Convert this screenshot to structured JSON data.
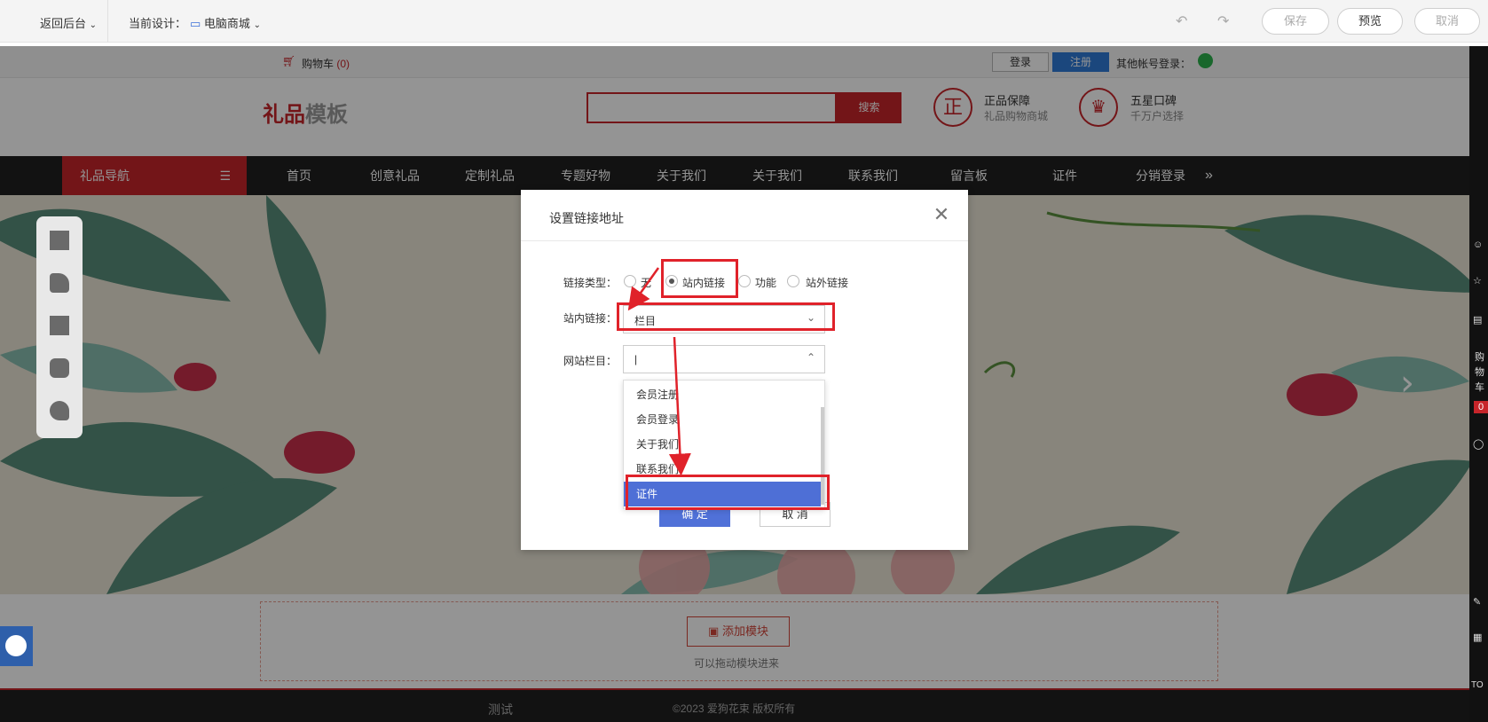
{
  "topbar": {
    "back": "返回后台",
    "current_design_label": "当前设计：",
    "current_design_value": "电脑商城",
    "save": "保存",
    "preview": "预览",
    "cancel": "取消"
  },
  "subbar": {
    "cart": "购物车",
    "cart_count": "(0)",
    "login": "登录",
    "register": "注册",
    "other_login": "其他帐号登录："
  },
  "header": {
    "logo_red": "礼品",
    "logo_gray": "模板",
    "search_button": "搜索",
    "badge1_icon": "正",
    "badge1_title": "正品保障",
    "badge1_sub": "礼品购物商城",
    "badge2_title": "五星口碑",
    "badge2_sub": "千万户选择"
  },
  "nav": {
    "category": "礼品导航",
    "items": [
      "首页",
      "创意礼品",
      "定制礼品",
      "专题好物",
      "关于我们",
      "关于我们",
      "联系我们",
      "留言板",
      "证件",
      "分销登录"
    ],
    "more": "»"
  },
  "add_module": {
    "button": "添加模块",
    "hint": "可以拖动模块进来"
  },
  "footer": {
    "left": "测试",
    "copyright": "©2023 爱狗花束 版权所有"
  },
  "rightbar": {
    "labels": [
      "购",
      "物",
      "车"
    ],
    "count": "0",
    "top": "TO"
  },
  "dialog": {
    "title": "设置链接地址",
    "link_type_label": "链接类型：",
    "radio_options": [
      "无",
      "站内链接",
      "功能",
      "站外链接"
    ],
    "selected_radio": "站内链接",
    "internal_link_label": "站内链接：",
    "internal_link_value": "栏目",
    "site_column_label": "网站栏目：",
    "site_column_value": "|",
    "dropdown_items": [
      "会员注册",
      "会员登录",
      "关于我们",
      "联系我们",
      "证件"
    ],
    "selected_item": "证件",
    "ok": "确 定",
    "cancel": "取 消"
  },
  "colors": {
    "accent_red": "#c7252a",
    "dialog_blue": "#5071d8",
    "annotation_red": "#e0222a"
  }
}
